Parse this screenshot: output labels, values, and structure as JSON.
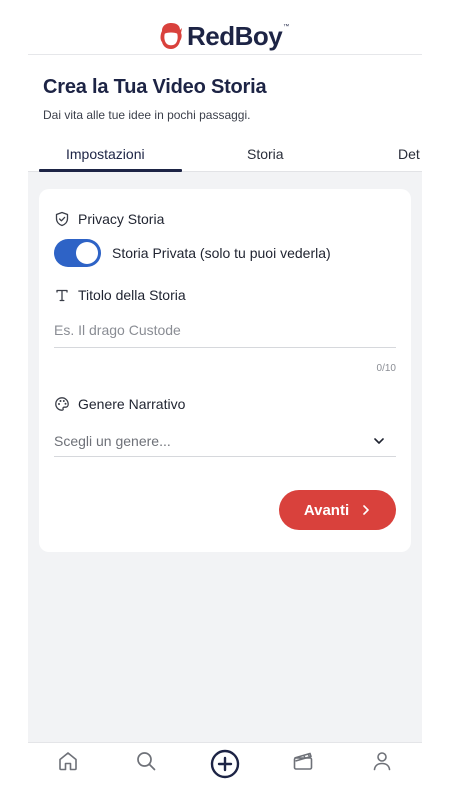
{
  "brand": {
    "name": "RedBoy",
    "tm": "™",
    "logo_color": "#d9413c",
    "text_color": "#1d2445"
  },
  "page": {
    "title": "Crea la Tua Video Storia",
    "subtitle": "Dai vita alle tue idee in pochi passaggi."
  },
  "tabs": [
    {
      "label": "Impostazioni",
      "active": true
    },
    {
      "label": "Storia",
      "active": false
    },
    {
      "label": "Det",
      "active": false
    }
  ],
  "form": {
    "privacy": {
      "label": "Privacy Storia",
      "icon": "shield-icon",
      "toggle_on": true,
      "toggle_label": "Storia Privata (solo tu puoi vederla)"
    },
    "title_field": {
      "label": "Titolo della Storia",
      "icon": "text-icon",
      "placeholder": "Es. Il drago Custode",
      "value": "",
      "counter": "0/10"
    },
    "genre": {
      "label": "Genere Narrativo",
      "icon": "palette-icon",
      "selected": "Scegli un genere..."
    },
    "next_button": {
      "label": "Avanti",
      "color": "#d9413c"
    }
  },
  "bottom_nav": [
    {
      "icon": "home-icon"
    },
    {
      "icon": "search-icon"
    },
    {
      "icon": "plus-circle-icon"
    },
    {
      "icon": "clapperboard-icon"
    },
    {
      "icon": "user-icon"
    }
  ],
  "colors": {
    "accent": "#2e63c6",
    "primary_dark": "#1d2445",
    "background": "#f2f3f5"
  }
}
